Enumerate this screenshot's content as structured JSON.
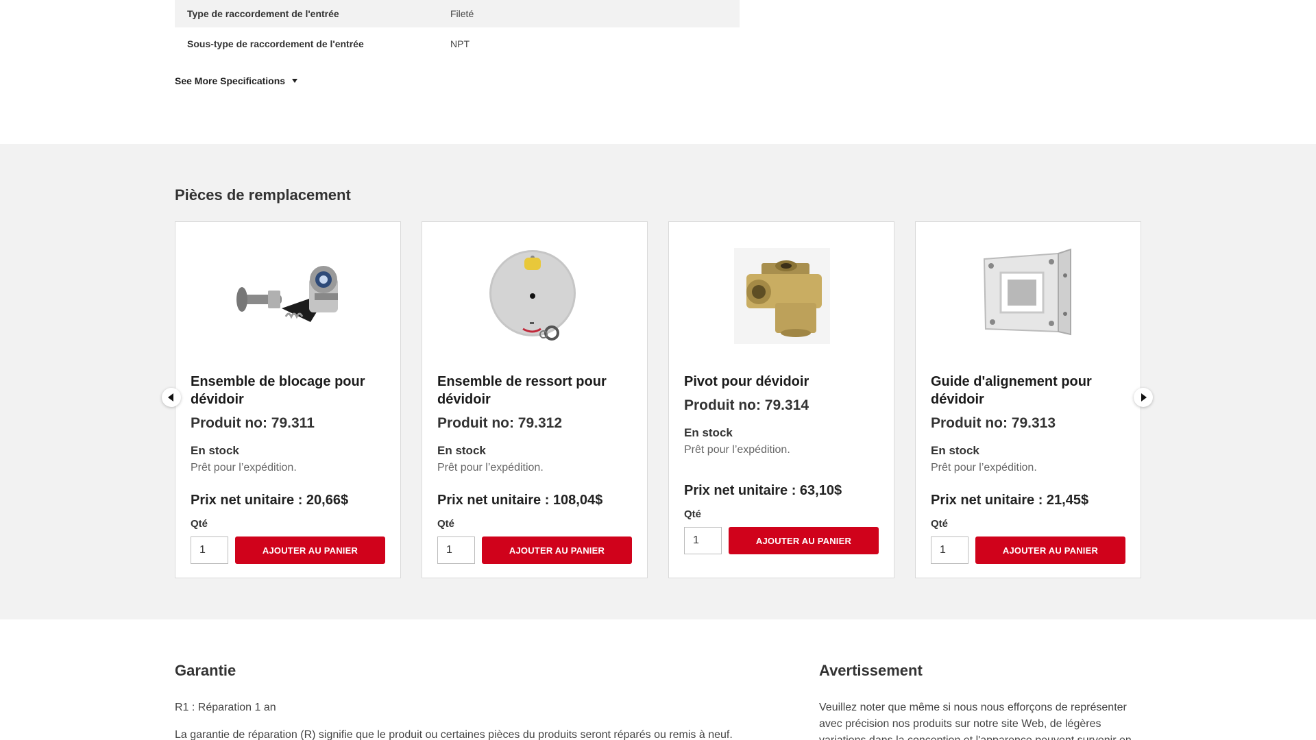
{
  "specs": {
    "rows": [
      {
        "key": "Type de raccordement de l'entrée",
        "value": "Fileté"
      },
      {
        "key": "Sous-type de raccordement de l'entrée",
        "value": "NPT"
      }
    ],
    "see_more": "See More Specifications"
  },
  "parts": {
    "title": "Pièces de remplacement",
    "prev_icon": "arrow-left-icon",
    "next_icon": "arrow-right-icon",
    "products": [
      {
        "name": "Ensemble de blocage pour dévidoir",
        "number": "Produit no: 79.311",
        "stock": "En stock",
        "ready": "Prêt pour l’expédition.",
        "price": "Prix net unitaire : 20,66$",
        "qty_label": "Qté",
        "qty": "1",
        "add": "AJOUTER AU PANIER"
      },
      {
        "name": "Ensemble de ressort pour dévidoir",
        "number": "Produit no: 79.312",
        "stock": "En stock",
        "ready": "Prêt pour l’expédition.",
        "price": "Prix net unitaire : 108,04$",
        "qty_label": "Qté",
        "qty": "1",
        "add": "AJOUTER AU PANIER"
      },
      {
        "name": "Pivot pour dévidoir",
        "number": "Produit no: 79.314",
        "stock": "En stock",
        "ready": "Prêt pour l’expédition.",
        "price": "Prix net unitaire : 63,10$",
        "qty_label": "Qté",
        "qty": "1",
        "add": "AJOUTER AU PANIER"
      },
      {
        "name": "Guide d'alignement pour dévidoir",
        "number": "Produit no: 79.313",
        "stock": "En stock",
        "ready": "Prêt pour l’expédition.",
        "price": "Prix net unitaire : 21,45$",
        "qty_label": "Qté",
        "qty": "1",
        "add": "AJOUTER AU PANIER"
      }
    ]
  },
  "warranty": {
    "title": "Garantie",
    "line1": "R1 : Réparation 1 an",
    "line2": "La garantie de réparation (R) signifie que le produit ou certaines pièces du produits seront réparés ou remis à neuf."
  },
  "warning": {
    "title": "Avertissement",
    "text": "Veuillez noter que même si nous nous efforçons de représenter avec précision nos produits sur notre site Web, de légères variations dans la conception et l'apparence peuvent survenir en"
  },
  "colors": {
    "accent": "#d0021b",
    "band": "#f2f2f2"
  }
}
